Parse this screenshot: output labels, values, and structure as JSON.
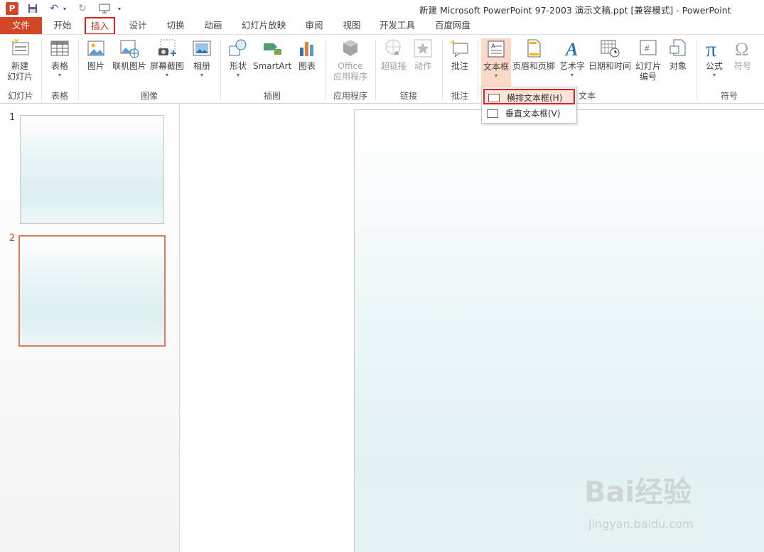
{
  "titlebar": {
    "logo": "P",
    "title": "新建 Microsoft PowerPoint 97-2003 演示文稿.ppt [兼容模式] - PowerPoint",
    "icons": [
      "save-icon",
      "undo-icon",
      "redo-icon",
      "start-from-beginning-icon",
      "customize-qat-icon"
    ]
  },
  "tabs": [
    {
      "label": "文件"
    },
    {
      "label": "开始"
    },
    {
      "label": "插入"
    },
    {
      "label": "设计"
    },
    {
      "label": "切换"
    },
    {
      "label": "动画"
    },
    {
      "label": "幻灯片放映"
    },
    {
      "label": "审阅"
    },
    {
      "label": "视图"
    },
    {
      "label": "开发工具"
    },
    {
      "label": "百度网盘"
    }
  ],
  "ribbon": {
    "buttons": [
      {
        "label": "新建\n幻灯片",
        "caret": "▾"
      },
      {
        "label": "表格",
        "caret": "▾"
      },
      {
        "label": "图片"
      },
      {
        "label": "联机图片"
      },
      {
        "label": "屏幕截图",
        "caret": "▾"
      },
      {
        "label": "相册",
        "caret": "▾"
      },
      {
        "label": "形状",
        "caret": "▾"
      },
      {
        "label": "SmartArt"
      },
      {
        "label": "图表"
      },
      {
        "label": "Office\n应用程序",
        "caret": "▾"
      },
      {
        "label": "超链接"
      },
      {
        "label": "动作"
      },
      {
        "label": "批注"
      },
      {
        "label": "文本框",
        "caret": "▾"
      },
      {
        "label": "页眉和页脚"
      },
      {
        "label": "艺术字",
        "caret": "▾"
      },
      {
        "label": "日期和时间"
      },
      {
        "label": "幻灯片\n编号"
      },
      {
        "label": "对象"
      },
      {
        "label": "公式",
        "caret": "▾"
      },
      {
        "label": "符号"
      }
    ],
    "groups": [
      "幻灯片",
      "表格",
      "图像",
      "插图",
      "应用程序",
      "链接",
      "批注",
      "文本",
      "符号"
    ]
  },
  "dropdown": {
    "items": [
      {
        "label": "横排文本框(H)"
      },
      {
        "label": "垂直文本框(V)"
      }
    ]
  },
  "slides": [
    {
      "number": "1"
    },
    {
      "number": "2"
    }
  ],
  "watermark": {
    "brand": "Bai经验",
    "url": "jingyan.baidu.com"
  },
  "colors": {
    "accent": "#d24726",
    "highlight": "#e02020",
    "selected_thumb": "#e07a5a"
  }
}
